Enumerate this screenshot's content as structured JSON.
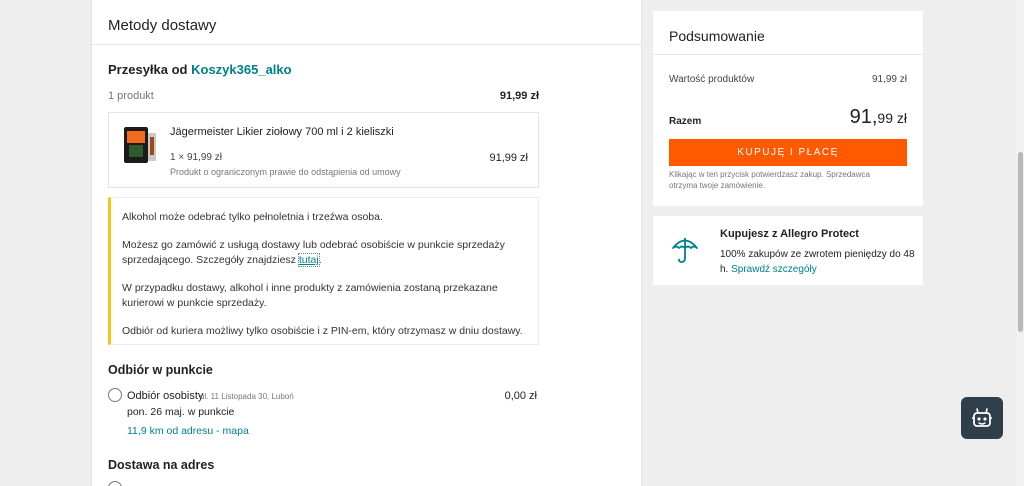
{
  "delivery": {
    "title": "Metody dostawy",
    "shipment_prefix": "Przesyłka od",
    "seller": "Koszyk365_alko",
    "product_count": "1 produkt",
    "subtotal": "91,99 zł"
  },
  "product": {
    "name": "Jägermeister Likier ziołowy 700 ml i 2 kieliszki",
    "qty_price": "1 × 91,99 zł",
    "price": "91,99 zł",
    "note": "Produkt o ograniczonym prawie do odstąpienia od umowy"
  },
  "alcohol_info": {
    "p1": "Alkohol może odebrać tylko pełnoletnia i trzeźwa osoba.",
    "p2": "Możesz go zamówić z usługą dostawy lub odebrać osobiście w punkcie sprzedaży sprzedającego. Szczegóły znajdziesz",
    "p2_link": "tutaj",
    "p2_end": ".",
    "p3": "W przypadku dostawy, alkohol i inne produkty z zamówienia zostaną przekazane kurierowi w punkcie sprzedaży.",
    "p4": "Odbiór od kuriera możliwy tylko osobiście i z PIN-em, który otrzymasz w dniu dostawy."
  },
  "pickup": {
    "section_title": "Odbiór w punkcie",
    "option_name": "Odbiór osobisty",
    "address": "ul. 11 Listopada 30, Luboń",
    "price": "0,00 zł",
    "date": "pon. 26 maj. w punkcie",
    "map_link": "11,9 km od adresu - mapa"
  },
  "address_delivery": {
    "section_title": "Dostawa na adres"
  },
  "summary": {
    "title": "Podsumowanie",
    "products_label": "Wartość produktów",
    "products_value": "91,99 zł",
    "total_label": "Razem",
    "total_main": "91,",
    "total_fraction": "99 zł",
    "buy_button": "KUPUJĘ I PŁACĘ",
    "buy_note": "Klikając w ten przycisk potwierdzasz zakup. Sprzedawca otrzyma twoje zamówienie."
  },
  "protect": {
    "title": "Kupujesz z Allegro Protect",
    "text": "100% zakupów ze zwrotem pieniędzy do 48 h.",
    "link": "Sprawdź szczegóły"
  },
  "colors": {
    "accent": "#00808b",
    "buy_button": "#ff5a00",
    "info_border": "#f5c518"
  },
  "icons": {
    "protect": "umbrella-icon",
    "assistant": "robot-icon"
  }
}
